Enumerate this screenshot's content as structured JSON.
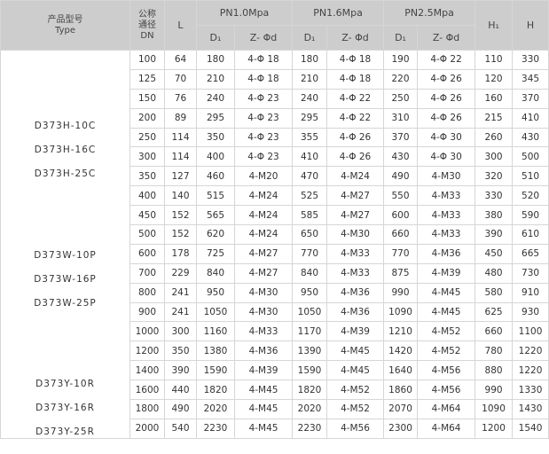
{
  "header": {
    "type_cn": "产品型号",
    "type_en": "Type",
    "dn_line1": "公称",
    "dn_line2": "通径",
    "dn_line3": "DN",
    "l": "L",
    "pn10": "PN1.0Mpa",
    "pn16": "PN1.6Mpa",
    "pn25": "PN2.5Mpa",
    "d1": "D₁",
    "zphi": "Z- Φd",
    "h1": "H₁",
    "h": "H"
  },
  "type_groups": [
    [
      "D373H-10C",
      "D373H-16C",
      "D373H-25C"
    ],
    [
      "D373W-10P",
      "D373W-16P",
      "D373W-25P"
    ],
    [
      "D373Y-10R",
      "D373Y-16R",
      "D373Y-25R"
    ]
  ],
  "rows": [
    [
      "100",
      "64",
      "180",
      "4-Φ 18",
      "180",
      "4-Φ 18",
      "190",
      "4-Φ 22",
      "110",
      "330"
    ],
    [
      "125",
      "70",
      "210",
      "4-Φ 18",
      "210",
      "4-Φ 18",
      "220",
      "4-Φ 26",
      "120",
      "345"
    ],
    [
      "150",
      "76",
      "240",
      "4-Φ 23",
      "240",
      "4-Φ 22",
      "250",
      "4-Φ 26",
      "160",
      "370"
    ],
    [
      "200",
      "89",
      "295",
      "4-Φ 23",
      "295",
      "4-Φ 22",
      "310",
      "4-Φ 26",
      "215",
      "410"
    ],
    [
      "250",
      "114",
      "350",
      "4-Φ 23",
      "355",
      "4-Φ 26",
      "370",
      "4-Φ 30",
      "260",
      "430"
    ],
    [
      "300",
      "114",
      "400",
      "4-Φ 23",
      "410",
      "4-Φ 26",
      "430",
      "4-Φ 30",
      "300",
      "500"
    ],
    [
      "350",
      "127",
      "460",
      "4-M20",
      "470",
      "4-M24",
      "490",
      "4-M30",
      "320",
      "510"
    ],
    [
      "400",
      "140",
      "515",
      "4-M24",
      "525",
      "4-M27",
      "550",
      "4-M33",
      "330",
      "520"
    ],
    [
      "450",
      "152",
      "565",
      "4-M24",
      "585",
      "4-M27",
      "600",
      "4-M33",
      "380",
      "590"
    ],
    [
      "500",
      "152",
      "620",
      "4-M24",
      "650",
      "4-M30",
      "660",
      "4-M33",
      "390",
      "610"
    ],
    [
      "600",
      "178",
      "725",
      "4-M27",
      "770",
      "4-M33",
      "770",
      "4-M36",
      "450",
      "665"
    ],
    [
      "700",
      "229",
      "840",
      "4-M27",
      "840",
      "4-M33",
      "875",
      "4-M39",
      "480",
      "730"
    ],
    [
      "800",
      "241",
      "950",
      "4-M30",
      "950",
      "4-M36",
      "990",
      "4-M45",
      "580",
      "910"
    ],
    [
      "900",
      "241",
      "1050",
      "4-M30",
      "1050",
      "4-M36",
      "1090",
      "4-M45",
      "625",
      "930"
    ],
    [
      "1000",
      "300",
      "1160",
      "4-M33",
      "1170",
      "4-M39",
      "1210",
      "4-M52",
      "660",
      "1100"
    ],
    [
      "1200",
      "350",
      "1380",
      "4-M36",
      "1390",
      "4-M45",
      "1420",
      "4-M52",
      "780",
      "1220"
    ],
    [
      "1400",
      "390",
      "1590",
      "4-M39",
      "1590",
      "4-M45",
      "1640",
      "4-M56",
      "880",
      "1220"
    ],
    [
      "1600",
      "440",
      "1820",
      "4-M45",
      "1820",
      "4-M52",
      "1860",
      "4-M56",
      "990",
      "1330"
    ],
    [
      "1800",
      "490",
      "2020",
      "4-M45",
      "2020",
      "4-M52",
      "2070",
      "4-M64",
      "1090",
      "1430"
    ],
    [
      "2000",
      "540",
      "2230",
      "4-M45",
      "2230",
      "4-M56",
      "2300",
      "4-M64",
      "1200",
      "1540"
    ]
  ]
}
